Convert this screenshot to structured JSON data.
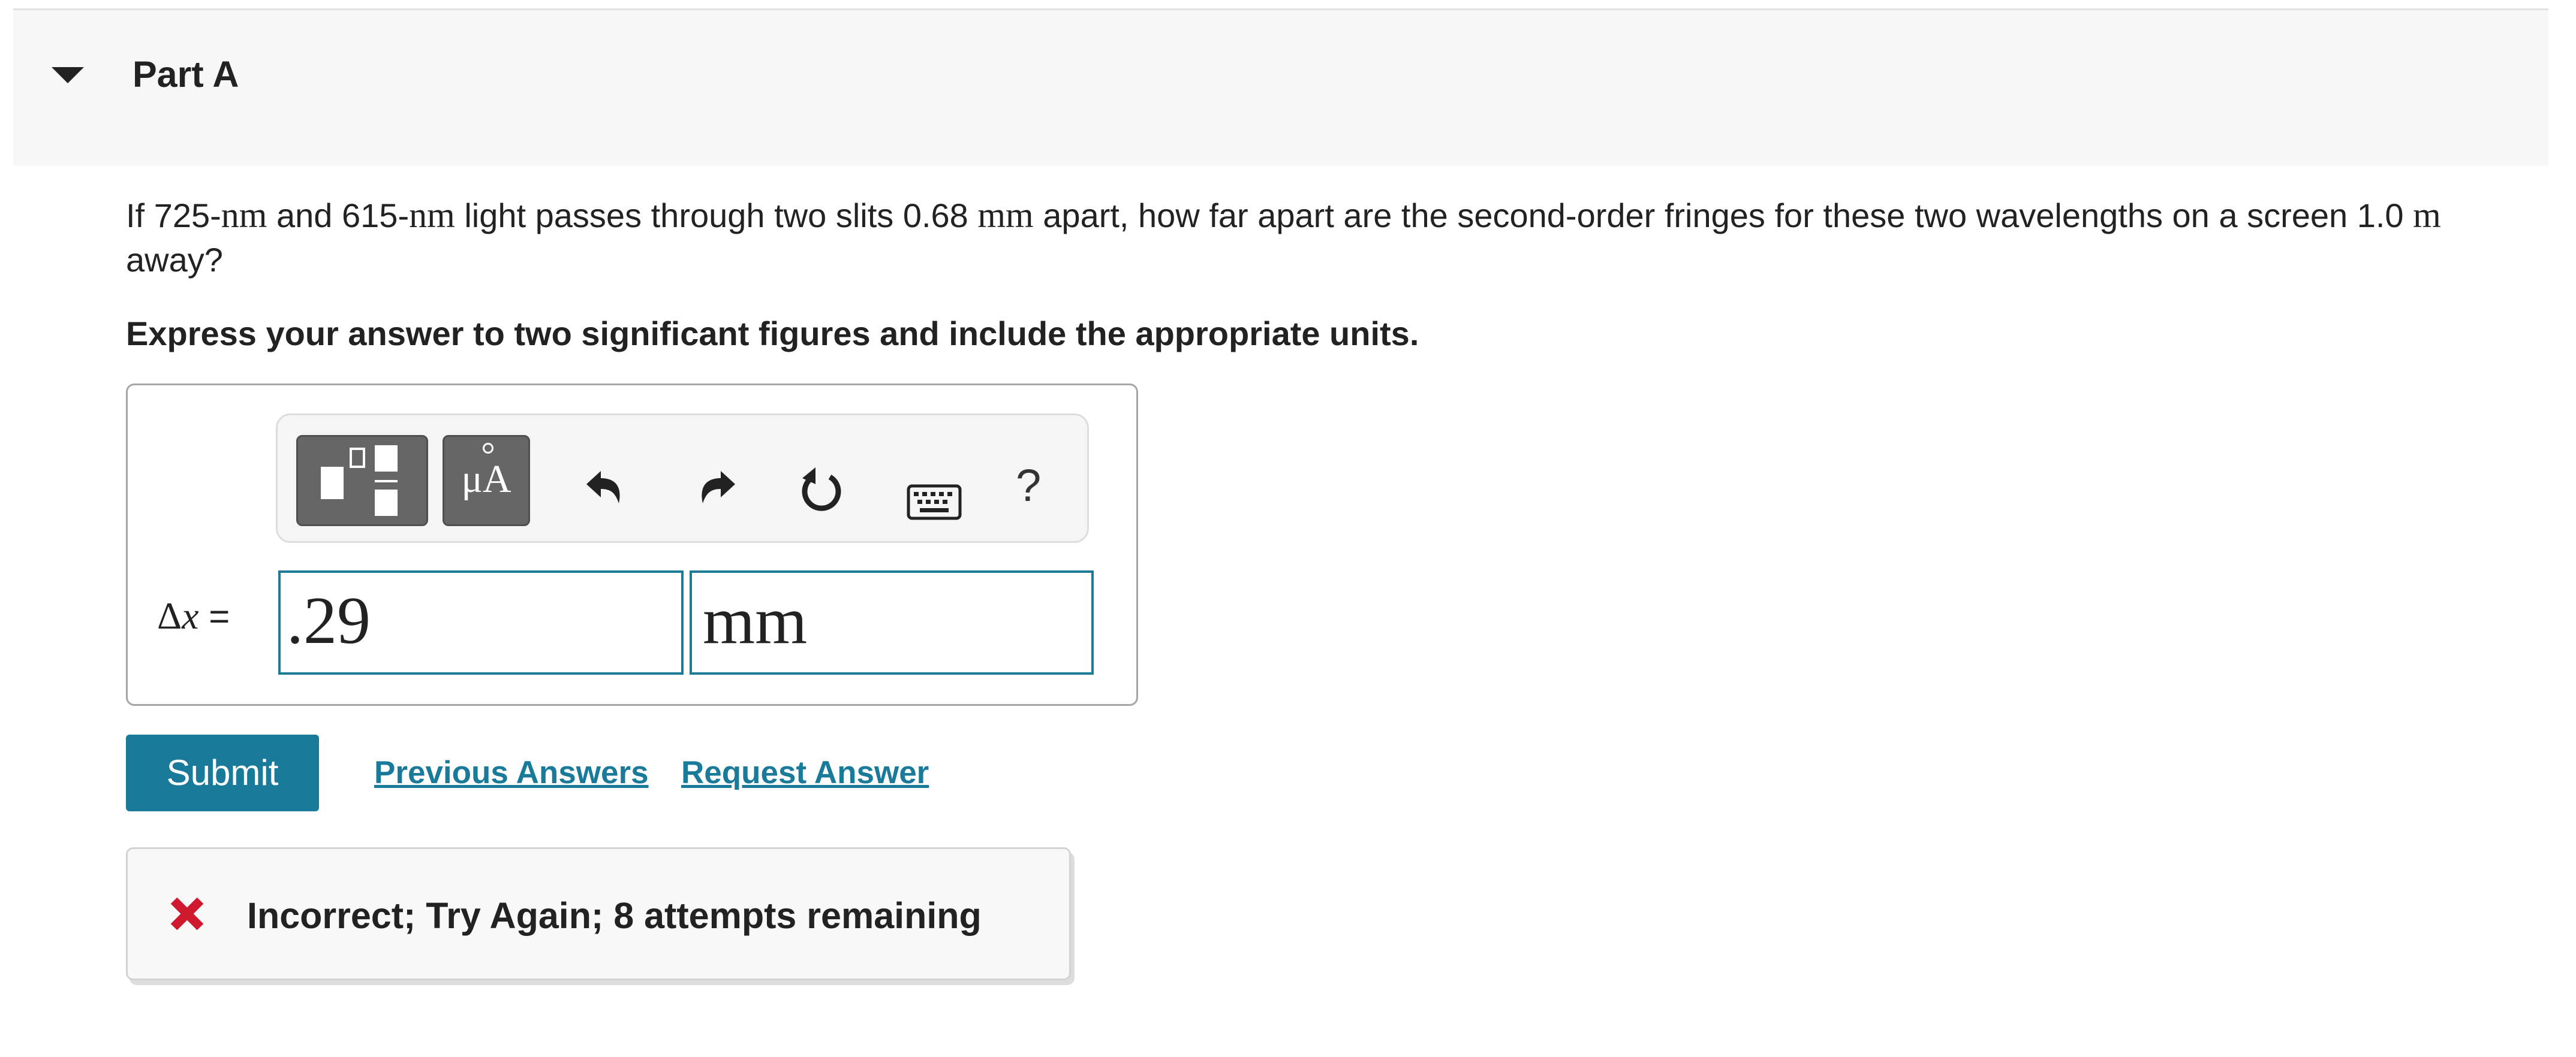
{
  "part": {
    "title": "Part A"
  },
  "question": {
    "lead": "If ",
    "lambda1_value": "725-",
    "lambda1_unit": "nm",
    "conj": " and ",
    "lambda2_value": "615-",
    "lambda2_unit": "nm",
    "middle": " light passes through two slits ",
    "slit_value": "0.68 ",
    "slit_unit": "mm",
    "rest": " apart, how far apart are the second-order fringes for these two wavelengths on a screen ",
    "screen_value": "1.0 ",
    "screen_unit": "m",
    "tail": " away?"
  },
  "instruction": "Express your answer to two significant figures and include the appropriate units.",
  "toolbar": {
    "units_label": "μA",
    "help_label": "?",
    "icons": [
      "templates-icon",
      "units-icon",
      "undo-icon",
      "redo-icon",
      "reset-icon",
      "keyboard-icon",
      "help-icon"
    ]
  },
  "answer": {
    "symbol_delta": "Δ",
    "symbol_var": "x",
    "equals": " =",
    "value": ".29",
    "units": "mm"
  },
  "actions": {
    "submit_label": "Submit",
    "previous_label": "Previous Answers",
    "request_label": "Request Answer"
  },
  "feedback": {
    "message": "Incorrect; Try Again; 8 attempts remaining"
  },
  "colors": {
    "accent": "#1a7a99",
    "field_border": "#1d7b96",
    "error": "#d0182f",
    "header_bg": "#f7f7f7"
  }
}
